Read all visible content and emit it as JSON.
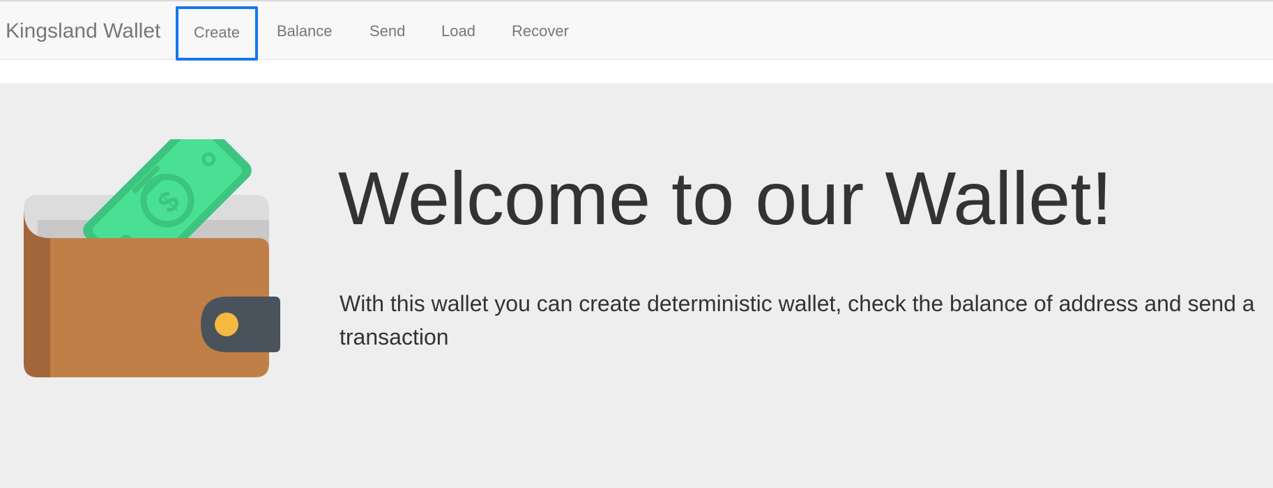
{
  "navbar": {
    "brand": "Kingsland Wallet",
    "items": [
      {
        "label": "Create"
      },
      {
        "label": "Balance"
      },
      {
        "label": "Send"
      },
      {
        "label": "Load"
      },
      {
        "label": "Recover"
      }
    ],
    "highlight_color": "#1677ee"
  },
  "hero": {
    "icon": "wallet-icon",
    "title": "Welcome to our Wallet!",
    "description": "With this wallet you can create deterministic wallet, check the balance of address and send a transaction"
  },
  "colors": {
    "nav_background": "#f8f8f8",
    "hero_background": "#eeeeee",
    "wallet_brown": "#c17f48",
    "money_green": "#4ade94"
  }
}
